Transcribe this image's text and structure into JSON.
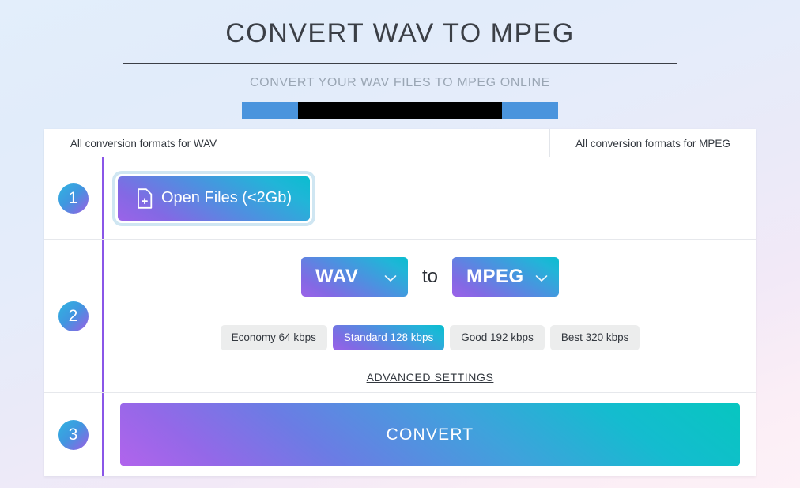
{
  "header": {
    "title": "CONVERT WAV TO MPEG",
    "subtitle": "CONVERT YOUR WAV FILES TO MPEG ONLINE"
  },
  "banner": {
    "redacted": ""
  },
  "tabs": [
    {
      "label": "All conversion formats for WAV"
    },
    {
      "label": ""
    },
    {
      "label": "All conversion formats for MPEG"
    }
  ],
  "steps": {
    "one": {
      "number": "1",
      "open_files_label": "Open Files (<2Gb)",
      "icon": "file-add-icon"
    },
    "two": {
      "number": "2",
      "source_format": "WAV",
      "to_label": "to",
      "target_format": "MPEG",
      "chevron_icon": "chevron-down-icon",
      "quality_options": [
        {
          "label": "Economy 64 kbps",
          "selected": false
        },
        {
          "label": "Standard 128 kbps",
          "selected": true
        },
        {
          "label": "Good 192 kbps",
          "selected": false
        },
        {
          "label": "Best 320 kbps",
          "selected": false
        }
      ],
      "advanced_settings_label": "ADVANCED SETTINGS"
    },
    "three": {
      "number": "3",
      "convert_label": "CONVERT"
    }
  },
  "colors": {
    "accent_purple": "#8a56e8",
    "accent_teal": "#03bfc7",
    "accent_blue": "#4a94dd",
    "text_dark": "#33383f",
    "text_muted": "#9aa6b4",
    "quality_idle_bg": "#eceded"
  }
}
